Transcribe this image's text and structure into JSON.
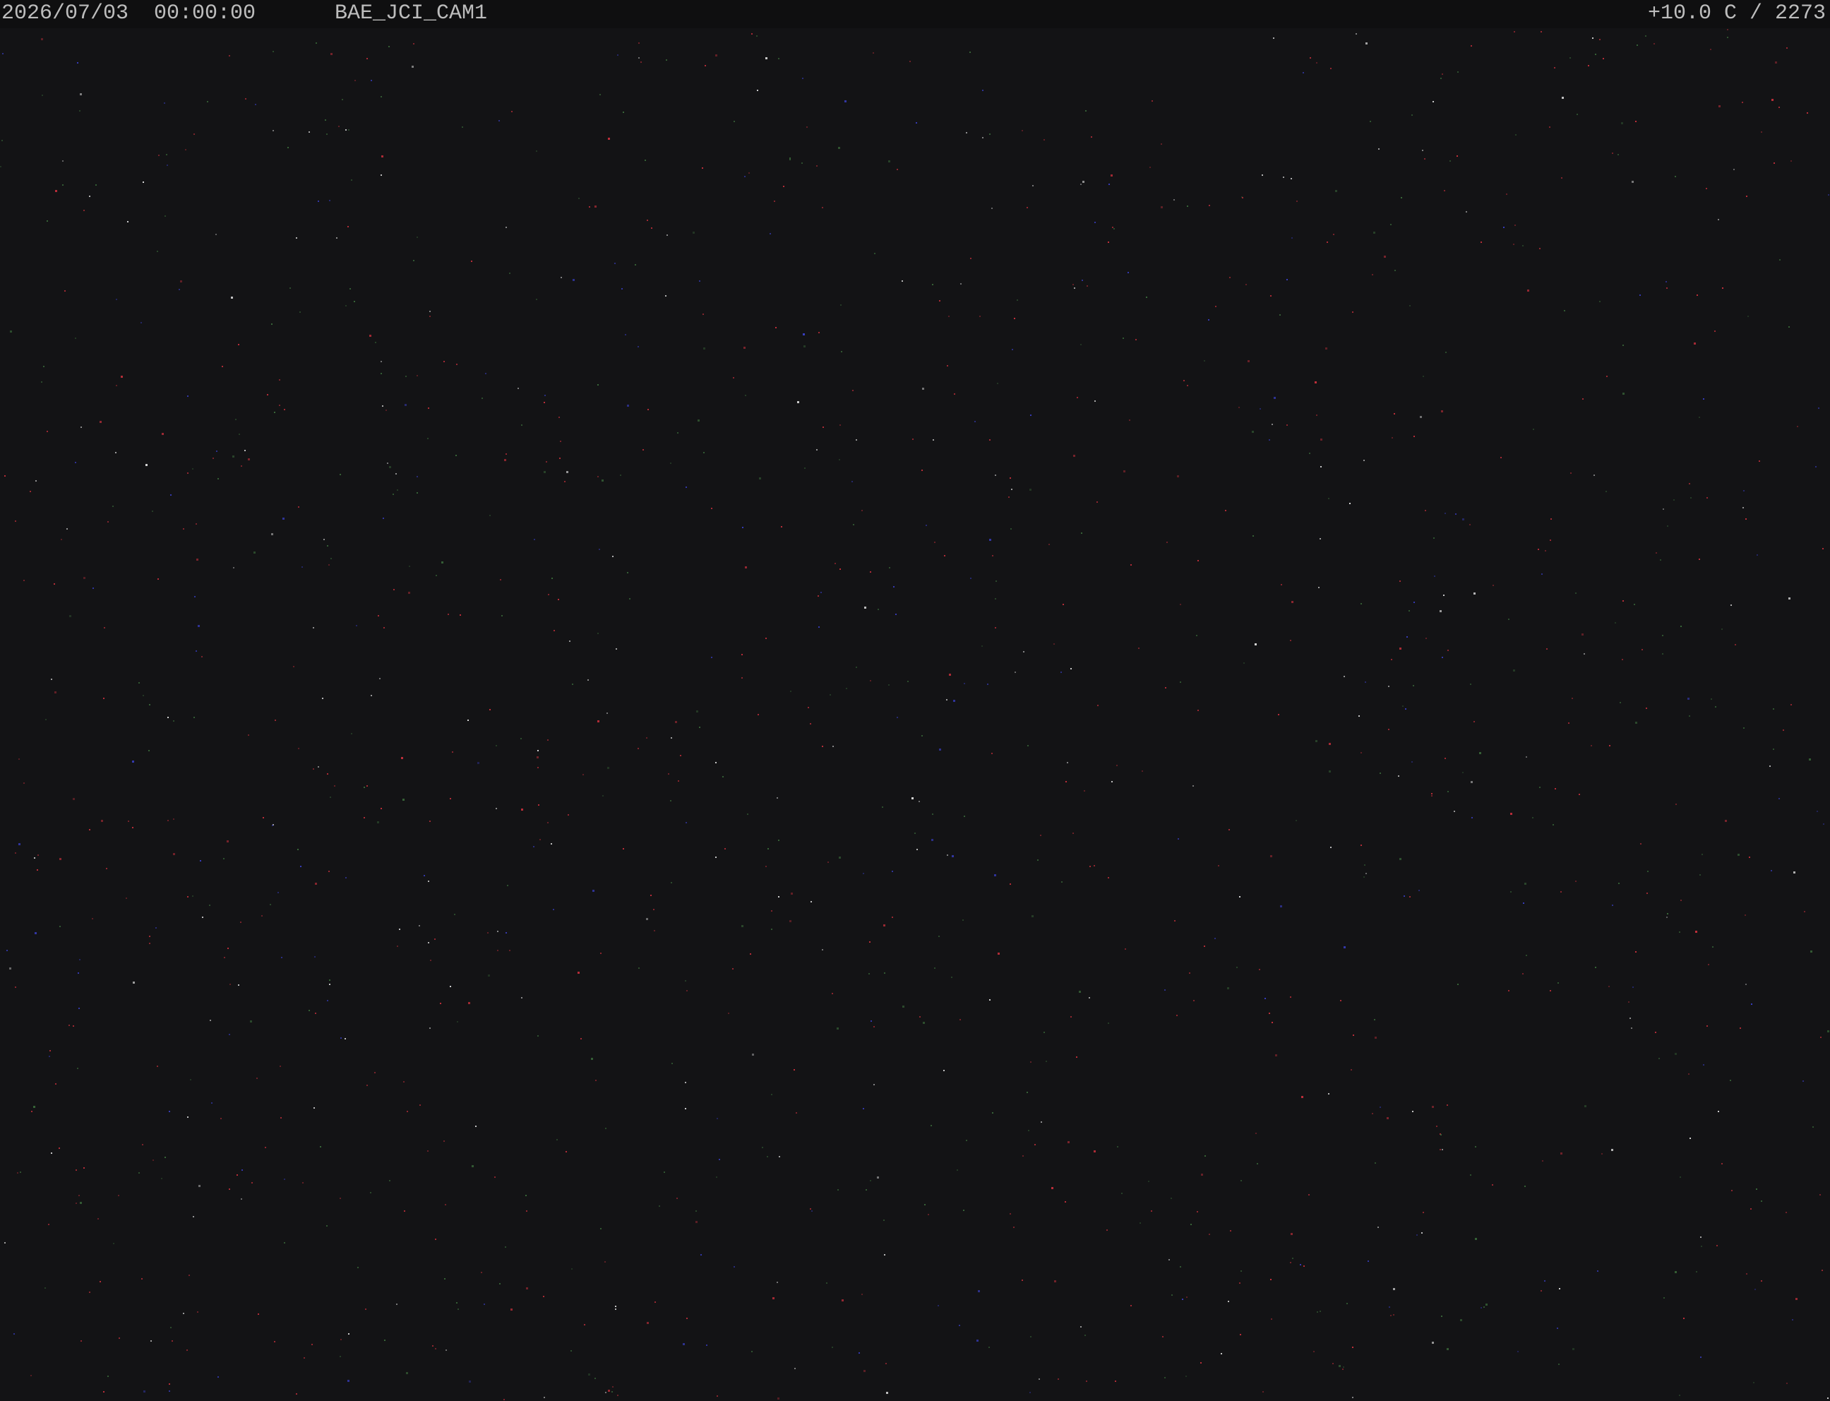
{
  "osd": {
    "date": "2026/07/03",
    "time": "00:00:00",
    "datetime": "2026/07/03  00:00:00",
    "camera_id": "BAE_JCI_CAM1",
    "status": "+10.0 C / 2273"
  },
  "colors": {
    "background": "#131315",
    "osd_bar": "#0f0f10",
    "osd_text": "#bdbdbd",
    "noise_red": "#c8303c",
    "noise_green": "#3a6a3a",
    "noise_blue": "#3a40c8",
    "noise_white": "#e0e0e0"
  }
}
